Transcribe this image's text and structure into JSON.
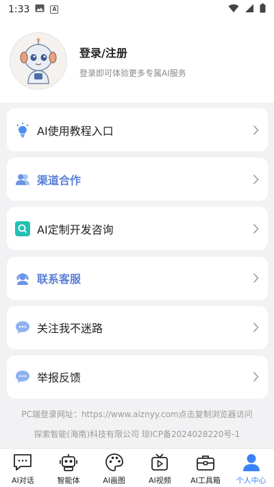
{
  "status_bar": {
    "time": "1:33"
  },
  "profile": {
    "title": "登录/注册",
    "subtitle": "登录即可体验更多专属AI服务"
  },
  "menu": [
    {
      "label": "AI使用教程入口",
      "icon": "lightbulb-icon",
      "accent": false
    },
    {
      "label": "渠道合作",
      "icon": "users-icon",
      "accent": true
    },
    {
      "label": "AI定制开发咨询",
      "icon": "search-square-icon",
      "accent": false
    },
    {
      "label": "联系客服",
      "icon": "headset-icon",
      "accent": true
    },
    {
      "label": "关注我不迷路",
      "icon": "chat-bubble-icon",
      "accent": false
    },
    {
      "label": "举报反馈",
      "icon": "chat-bubble-icon",
      "accent": false
    }
  ],
  "footer": {
    "line1": "PC端登录网址：https://www.aiznyy.com点击复制浏览器访问",
    "line2": "探索智能(海南)科技有限公司 琼ICP备2024028220号-1"
  },
  "tabs": [
    {
      "label": "AI对话",
      "icon": "chat-icon",
      "active": false
    },
    {
      "label": "智能体",
      "icon": "robot-icon",
      "active": false
    },
    {
      "label": "AI画图",
      "icon": "palette-icon",
      "active": false
    },
    {
      "label": "AI视频",
      "icon": "video-icon",
      "active": false
    },
    {
      "label": "AI工具箱",
      "icon": "toolbox-icon",
      "active": false
    },
    {
      "label": "个人中心",
      "icon": "person-icon",
      "active": true
    }
  ],
  "colors": {
    "accent": "#5a7fd6",
    "active_tab": "#3b82f6",
    "background": "#f2f2f4"
  }
}
